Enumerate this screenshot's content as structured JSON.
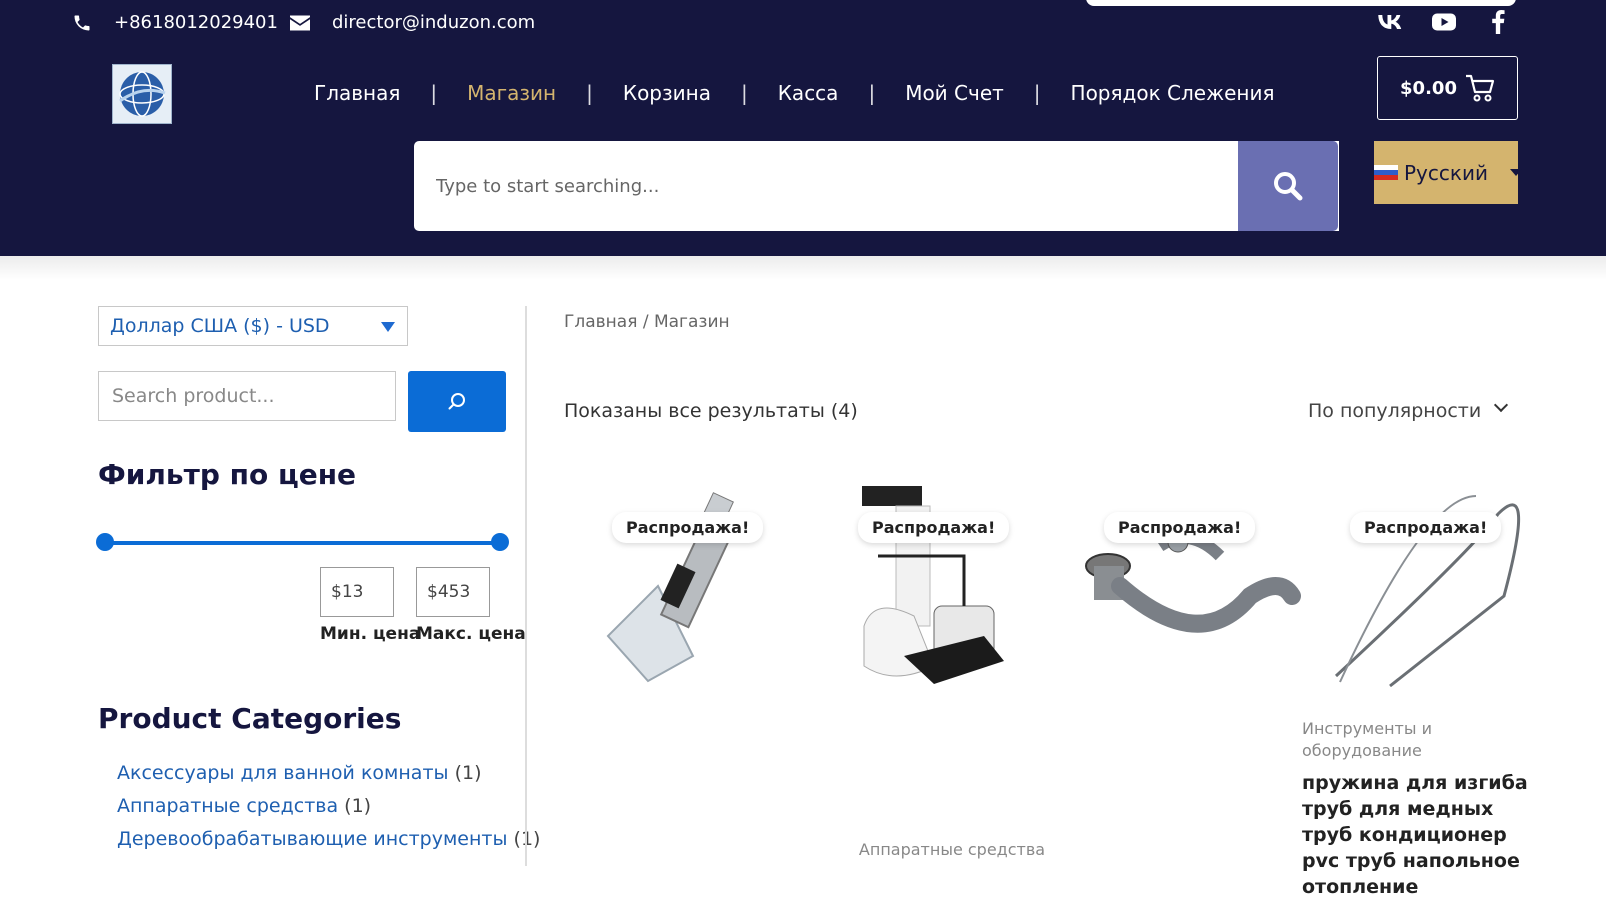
{
  "topbar": {
    "phone": "+8618012029401",
    "email": "director@induzon.com",
    "social": [
      "vk-icon",
      "youtube-icon",
      "facebook-icon"
    ]
  },
  "nav": {
    "items": [
      {
        "label": "Главная",
        "active": false
      },
      {
        "label": "Магазин",
        "active": true
      },
      {
        "label": "Корзина",
        "active": false
      },
      {
        "label": "Касса",
        "active": false
      },
      {
        "label": "Мой Счет",
        "active": false
      },
      {
        "label": "Порядок Слежения",
        "active": false
      }
    ],
    "separator": "|"
  },
  "cart": {
    "total": "$0.00",
    "icon": "cart-icon"
  },
  "search": {
    "placeholder": "Type to start searching...",
    "icon": "search-icon"
  },
  "language": {
    "label": "Русский",
    "icon": "flag-ru-icon"
  },
  "sidebar": {
    "currency": "Доллар США ($) - USD",
    "product_search_placeholder": "Search product...",
    "filter_title": "Фильтр по цене",
    "price_min": "$13",
    "price_max": "$453",
    "min_label": "Мин. цена",
    "max_label": "Макс. цена",
    "categories_title": "Product Categories",
    "categories": [
      {
        "name": "Аксессуары для ванной комнаты",
        "count": "(1)"
      },
      {
        "name": "Аппаратные средства",
        "count": "(1)"
      },
      {
        "name": "Деревообрабатывающие инструменты",
        "count": "(1)"
      }
    ]
  },
  "main": {
    "breadcrumb": "Главная / Магазин",
    "results": "Показаны все результаты (4)",
    "sort": "По популярности",
    "products": [
      {
        "badge": "Распродажа!",
        "image": "carpet-cleaning-wand-image",
        "category": "",
        "name": ""
      },
      {
        "badge": "Распродажа!",
        "image": "dust-collector-image",
        "category": "Аппаратные средства",
        "name": ""
      },
      {
        "badge": "Распродажа!",
        "image": "bathtub-drain-hose-image",
        "category": "",
        "name": ""
      },
      {
        "badge": "Распродажа!",
        "image": "pipe-bending-spring-image",
        "category": "Инструменты и оборудование",
        "name": "пружина для изгиба труб для медных труб кондиционер pvc труб напольное отопление"
      }
    ]
  },
  "colors": {
    "header_bg": "#15163f",
    "accent_gold": "#d4b46e",
    "search_button": "#6a6fb2",
    "link_blue": "#1e5fb0",
    "primary_blue": "#0b6cd6"
  }
}
